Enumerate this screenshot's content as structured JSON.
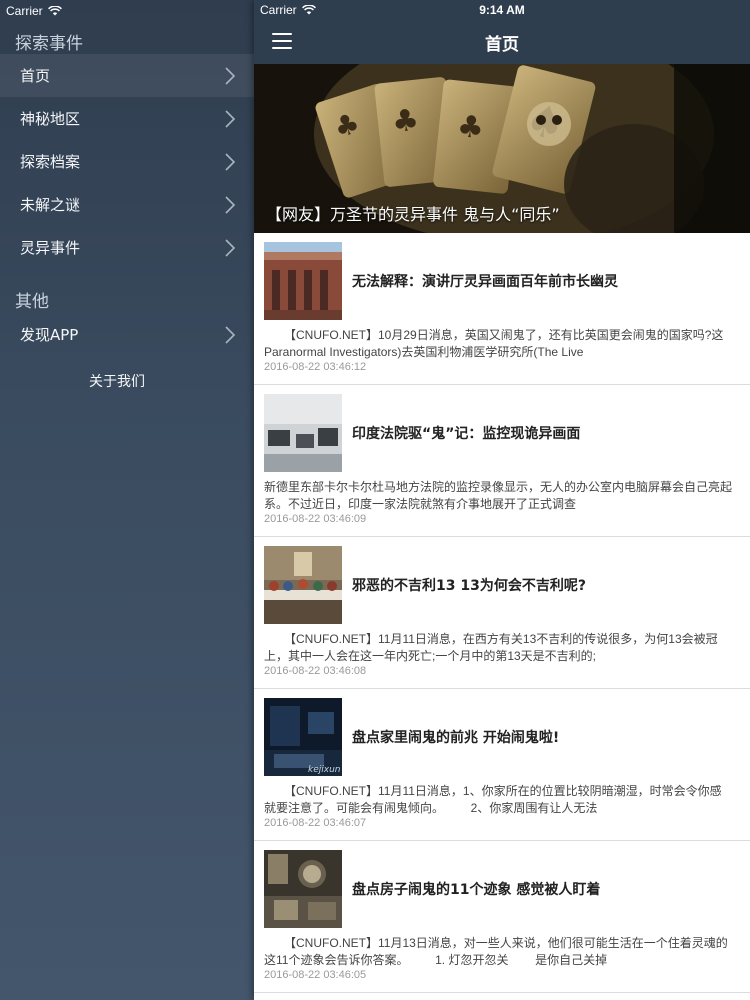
{
  "status": {
    "carrier": "Carrier",
    "time": "9:14 AM"
  },
  "sidebar": {
    "section1_title": "探索事件",
    "items": [
      {
        "label": "首页"
      },
      {
        "label": "神秘地区"
      },
      {
        "label": "探索档案"
      },
      {
        "label": "未解之谜"
      },
      {
        "label": "灵异事件"
      }
    ],
    "section2_title": "其他",
    "other_items": [
      {
        "label": "发现APP"
      }
    ],
    "about_label": "关于我们"
  },
  "navbar": {
    "title": "首页",
    "menu_icon": "hamburger-icon"
  },
  "banner": {
    "caption": "【网友】万圣节的灵异事件 鬼与人“同乐”"
  },
  "articles": [
    {
      "title": "无法解释：演讲厅灵异画面百年前市长幽灵",
      "summary": "      【CNUFO.NET】10月29日消息，英国又闹鬼了，还有比英国更会闹鬼的国家吗?这\nParanormal Investigators)去英国利物浦医学研究所(The Live",
      "date": "2016-08-22 03:46:12"
    },
    {
      "title": "印度法院驱“鬼”记：监控现诡异画面",
      "summary": "新德里东部卡尔卡尔杜马地方法院的监控录像显示，无人的办公室内电脑屏幕会自己亮起\n系。不过近日，印度一家法院就煞有介事地展开了正式调查",
      "date": "2016-08-22 03:46:09"
    },
    {
      "title": "邪恶的不吉利13 13为何会不吉利呢?",
      "summary": "      【CNUFO.NET】11月11日消息，在西方有关13不吉利的传说很多，为何13会被冠\n上，其中一人会在这一年内死亡;一个月中的第13天是不吉利的;",
      "date": "2016-08-22 03:46:08"
    },
    {
      "title": "盘点家里闹鬼的前兆 开始闹鬼啦!",
      "summary": "      【CNUFO.NET】11月11日消息，1、你家所在的位置比较阴暗潮湿，时常会令你感\n就要注意了。可能会有闹鬼倾向。        2、你家周围有让人无法",
      "date": "2016-08-22 03:46:07"
    },
    {
      "title": "盘点房子闹鬼的11个迹象 感觉被人盯着",
      "summary": "      【CNUFO.NET】11月13日消息，对一些人来说，他们很可能生活在一个住着灵魂的\n这11个迹象会告诉你答案。        1. 灯忽开忽关        是你自己关掉",
      "date": "2016-08-22 03:46:05"
    }
  ]
}
